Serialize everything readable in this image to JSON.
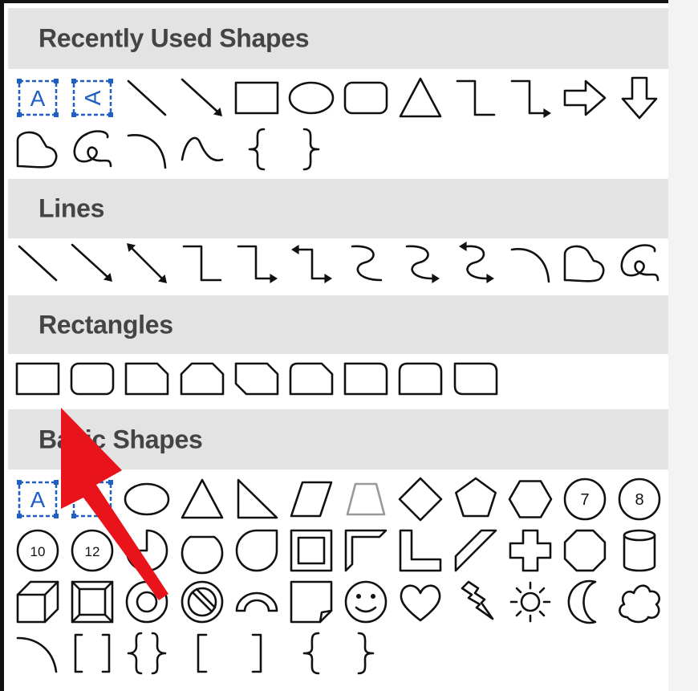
{
  "categories": [
    {
      "label": "Recently Used Shapes",
      "rows": [
        [
          "text-box",
          "vertical-text-box",
          "line",
          "line-arrow",
          "rectangle",
          "oval",
          "rounded-rectangle",
          "triangle",
          "elbow-connector",
          "elbow-arrow-connector",
          "right-arrow",
          "down-arrow"
        ],
        [
          "freeform-shape",
          "freeform-scribble",
          "curve",
          "curve-s",
          "left-brace",
          "right-brace"
        ]
      ]
    },
    {
      "label": "Lines",
      "rows": [
        [
          "line",
          "line-arrow",
          "line-double-arrow",
          "elbow-connector",
          "elbow-arrow-connector",
          "elbow-double-arrow-connector",
          "curved-connector",
          "curved-arrow-connector",
          "curved-double-arrow-connector",
          "curve",
          "freeform-shape",
          "freeform-scribble"
        ]
      ]
    },
    {
      "label": "Rectangles",
      "rows": [
        [
          "rectangle",
          "rounded-rectangle",
          "single-corner-snipped-rectangle",
          "same-side-corner-snipped-rectangle",
          "diagonal-corner-snipped-rectangle",
          "snip-and-round-rectangle",
          "single-corner-rounded-rectangle",
          "same-side-corner-rounded-rectangle",
          "diagonal-corner-rounded-rectangle"
        ]
      ]
    },
    {
      "label": "Basic Shapes",
      "rows": [
        [
          "text-box",
          "vertical-text-box",
          "oval",
          "isosceles-triangle",
          "right-triangle",
          "parallelogram",
          "trapezoid",
          "diamond",
          "pentagon",
          "hexagon",
          "heptagon",
          "octagon"
        ],
        [
          "decagon",
          "dodecagon",
          "partial-circle",
          "teardrop-chord",
          "teardrop",
          "frame",
          "half-frame",
          "l-shape",
          "diagonal-stripe",
          "cross",
          "plaque",
          "can"
        ],
        [
          "cube",
          "bevel",
          "donut",
          "no-symbol",
          "block-arc",
          "folded-corner",
          "smiley-face",
          "heart",
          "lightning-bolt",
          "sun",
          "moon",
          "cloud"
        ],
        [
          "arc",
          "double-bracket",
          "double-brace",
          "left-bracket",
          "right-bracket",
          "left-brace",
          "right-brace"
        ]
      ]
    }
  ],
  "badges": {
    "heptagon": "7",
    "octagon": "8",
    "decagon": "10",
    "dodecagon": "12"
  },
  "colors": {
    "header_bg": "#e3e3e3",
    "header_text": "#444444",
    "shape_stroke": "#111111",
    "text_box_accent": "#1f5fc1",
    "pointer_arrow": "#e8131b"
  }
}
